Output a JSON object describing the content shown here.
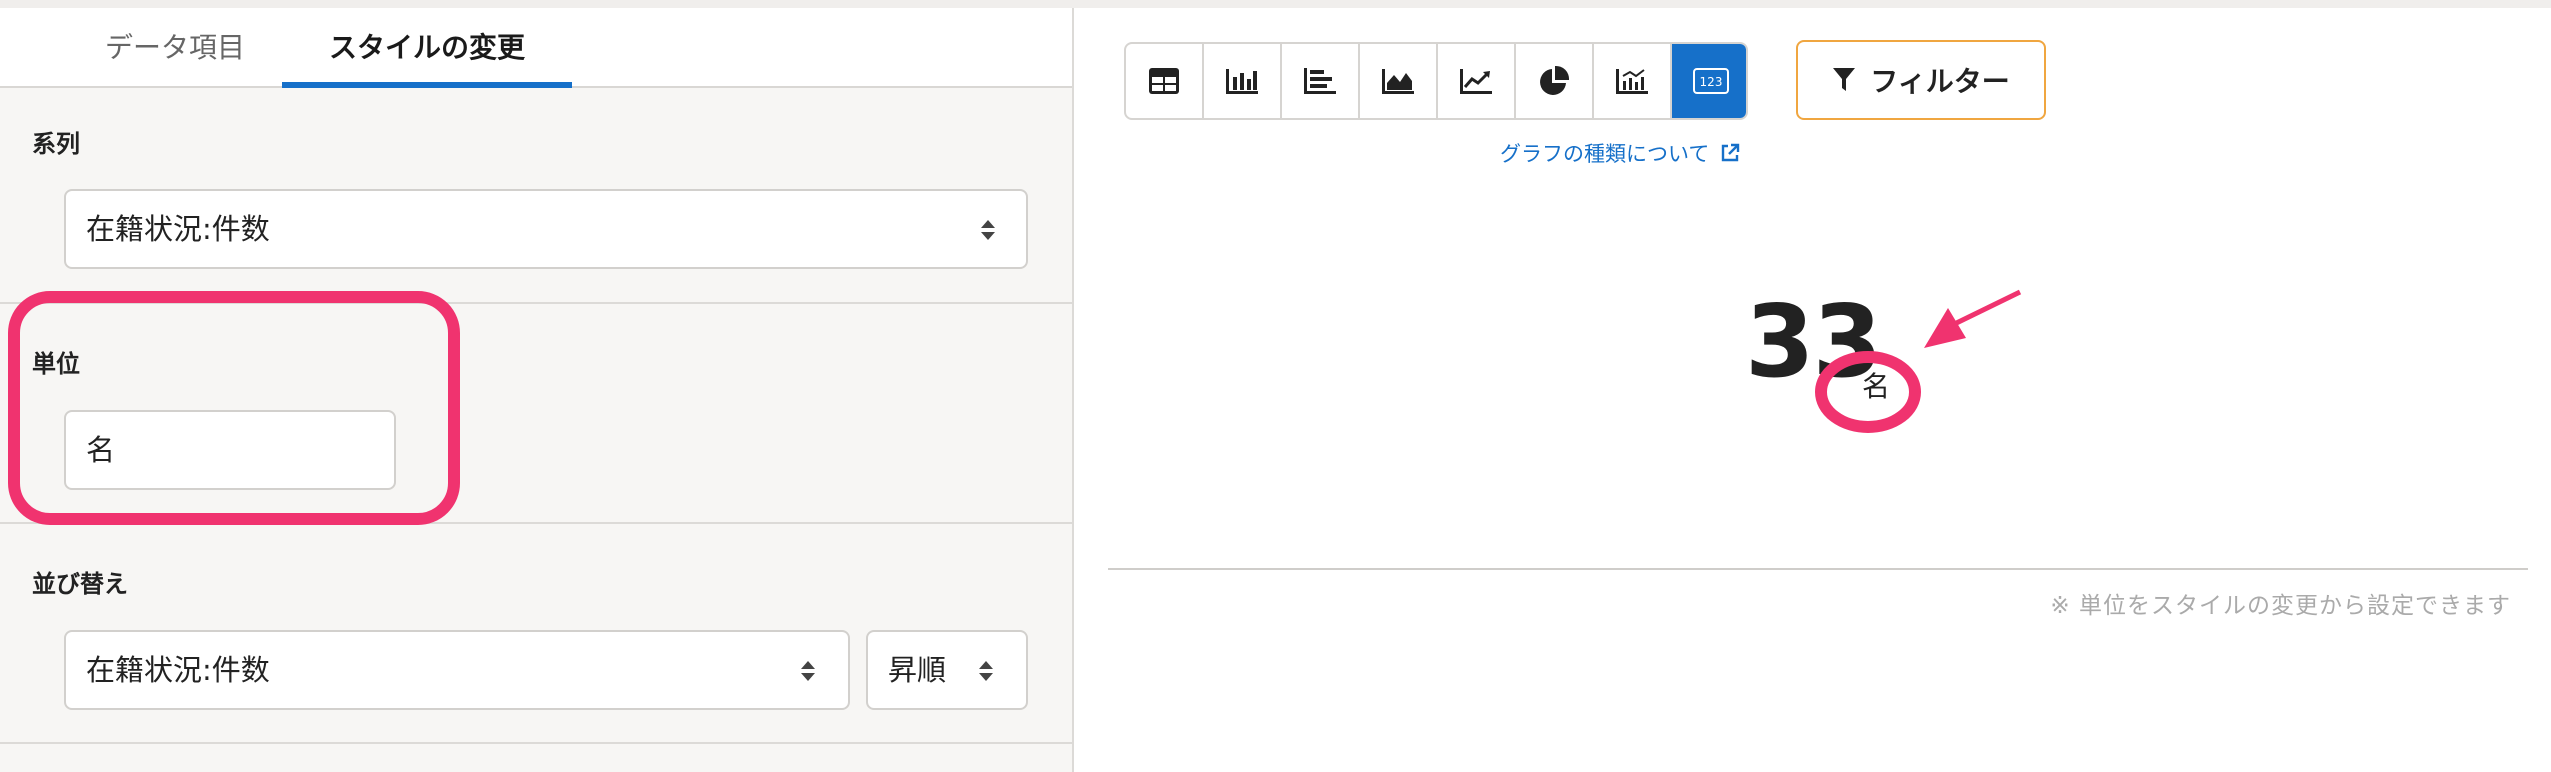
{
  "tabs": [
    {
      "label": "データ項目"
    },
    {
      "label": "スタイルの変更"
    }
  ],
  "series": {
    "label": "系列",
    "value": "在籍状況:件数"
  },
  "unit": {
    "label": "単位",
    "value": "名"
  },
  "sort": {
    "label": "並び替え",
    "field_value": "在籍状況:件数",
    "order_value": "昇順"
  },
  "toolbar": {
    "chart_types": [
      "table-icon",
      "bar-chart-icon",
      "horizontal-bar-icon",
      "area-chart-icon",
      "line-chart-icon",
      "pie-chart-icon",
      "combo-chart-icon",
      "number-icon"
    ],
    "active_index": 7,
    "number_icon_text": "123",
    "filter_label": "フィルター",
    "graph_types_link": "グラフの種類について"
  },
  "display": {
    "value": "33",
    "unit": "名"
  },
  "note": "※ 単位をスタイルの変更から設定できます",
  "colors": {
    "accent": "#1670c9",
    "highlight": "#f0336f",
    "filter_border": "#f0a640"
  }
}
